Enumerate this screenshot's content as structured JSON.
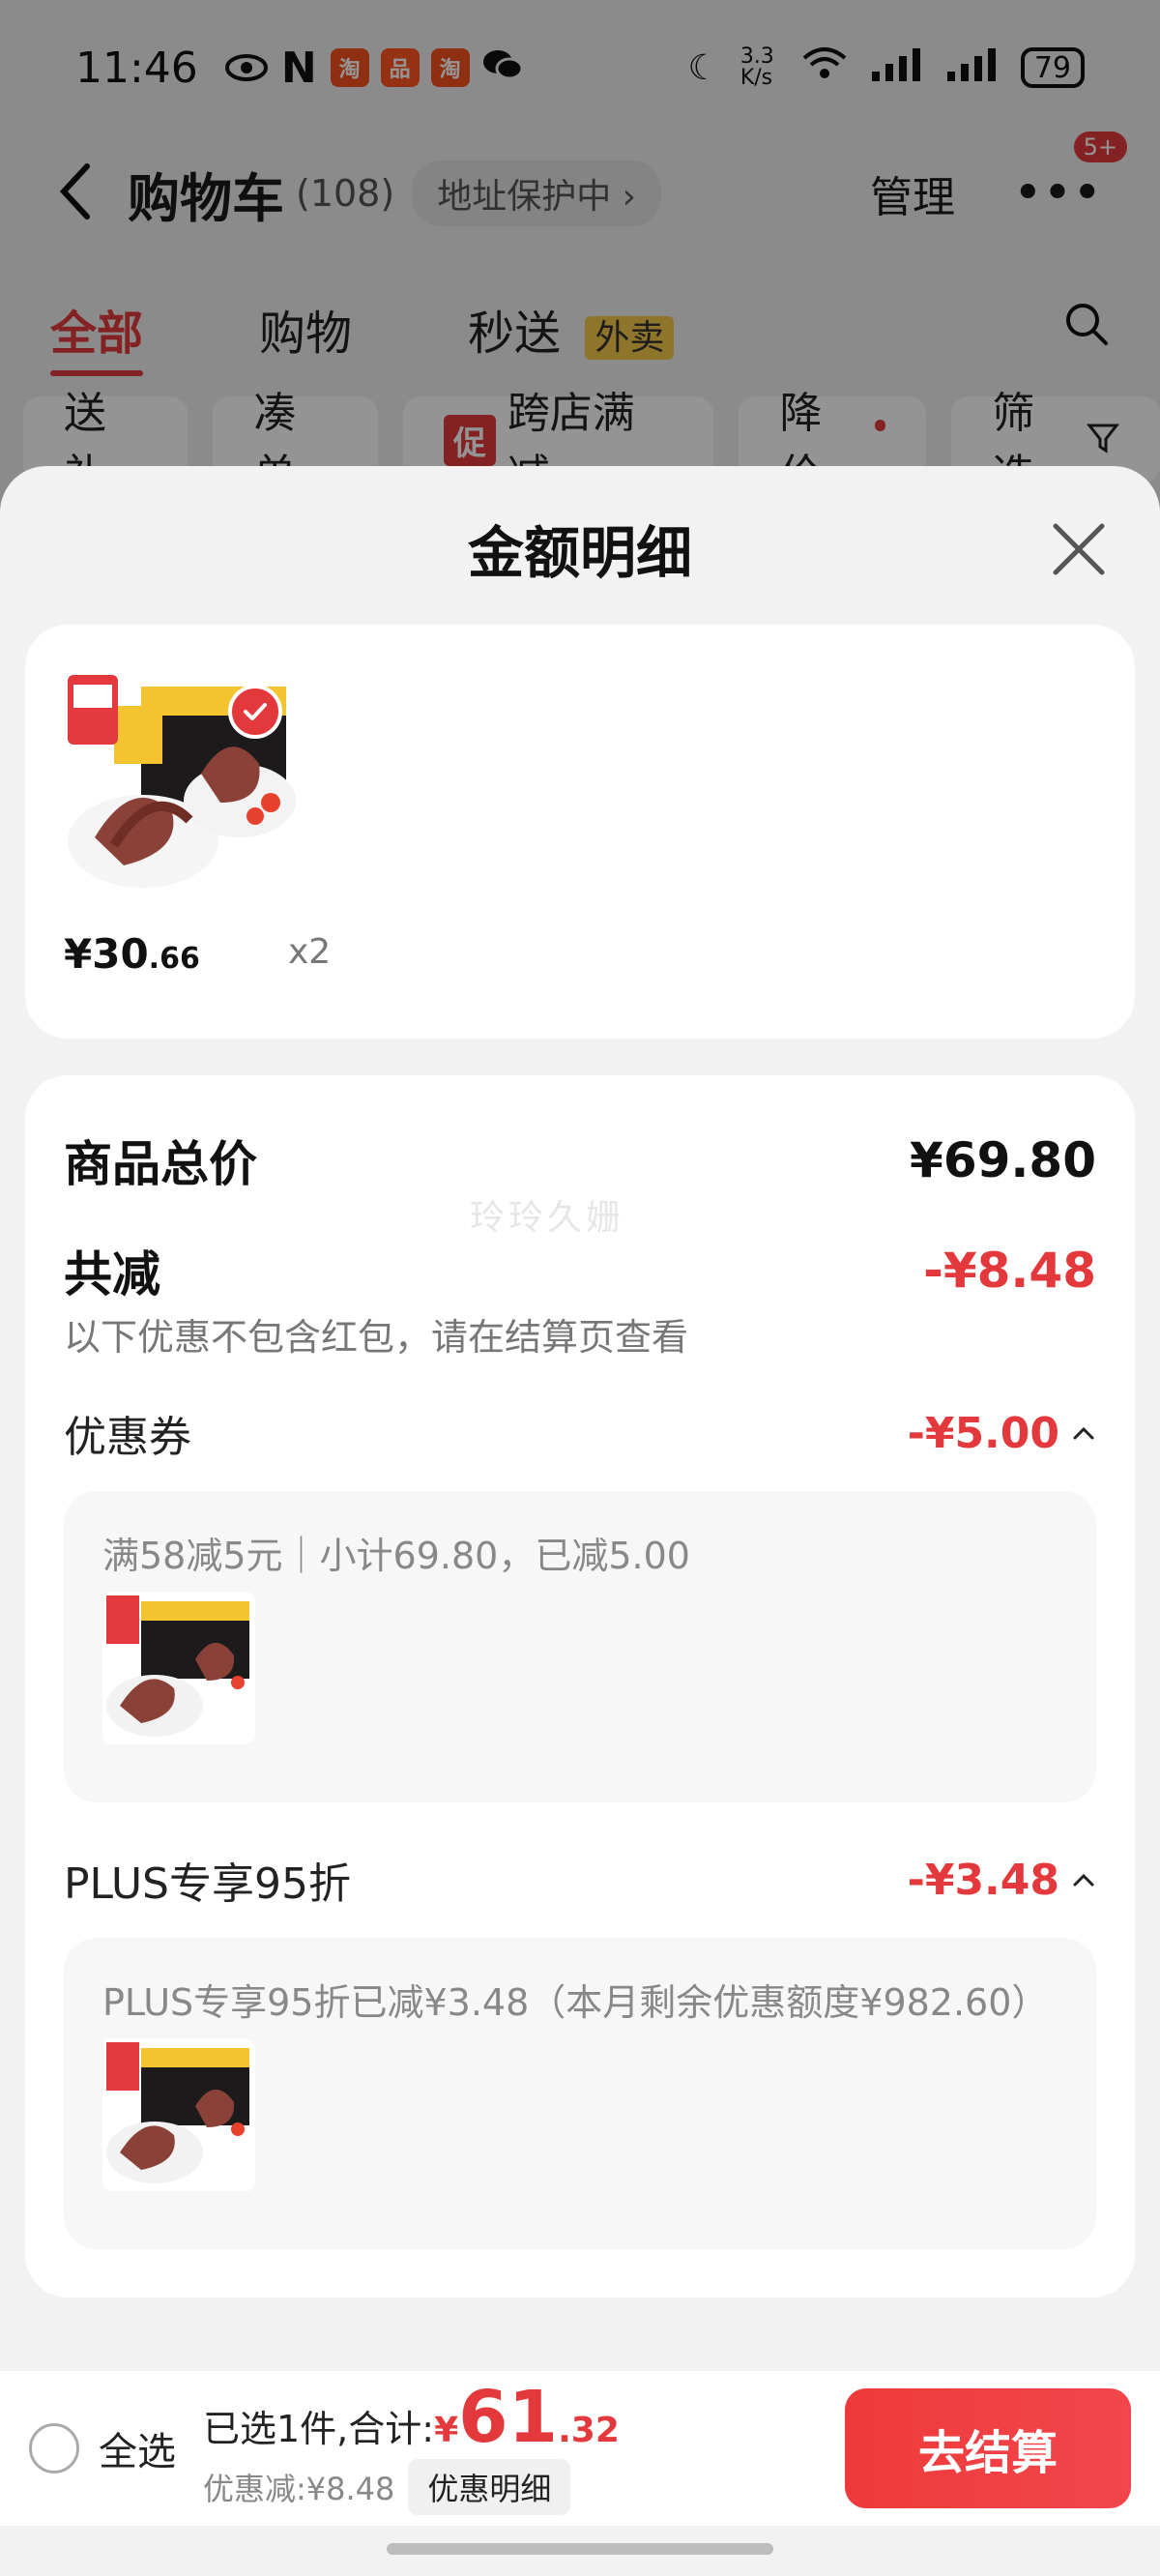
{
  "status_bar": {
    "time": "11:46",
    "network_speed": "3.3 K/s",
    "battery": "79",
    "app_icons": [
      "eye-icon",
      "nfc-icon",
      "taobao-icon",
      "xiaohongshu-icon",
      "taobao-icon",
      "wechat-icon"
    ]
  },
  "header": {
    "title": "购物车",
    "count": "(108)",
    "address_pill": "地址保护中",
    "manage": "管理",
    "more_badge": "5+"
  },
  "tabs": [
    {
      "label": "全部",
      "active": true
    },
    {
      "label": "购物",
      "active": false
    },
    {
      "label": "秒送",
      "badge": "外卖",
      "active": false
    }
  ],
  "chips": [
    {
      "label": "送礼"
    },
    {
      "label": "凑单"
    },
    {
      "label": "跨店满减",
      "icon_text": "促"
    },
    {
      "label": "降价"
    },
    {
      "label": "筛选"
    }
  ],
  "sheet": {
    "title": "金额明细",
    "product": {
      "price_int": "¥30",
      "price_dec": ".66",
      "qty": "x2",
      "check_color": "#e4393c"
    },
    "total": {
      "label": "商品总价",
      "value": "¥69.80"
    },
    "reduced": {
      "label": "共减",
      "value": "-¥8.48",
      "note": "以下优惠不包含红包，请在结算页查看"
    },
    "watermark": "玲玲久姗",
    "coupon": {
      "label": "优惠券",
      "value": "-¥5.00",
      "detail": "满58减5元｜小计69.80，已减5.00"
    },
    "plus": {
      "label": "PLUS专享95折",
      "value": "-¥3.48",
      "detail": "PLUS专享95折已减¥3.48（本月剩余优惠额度¥982.60）"
    }
  },
  "footer": {
    "select_all": "全选",
    "summary_label": "已选1件,合计:",
    "yen": "¥",
    "total_int": "61",
    "total_dec": ".32",
    "discount_text": "优惠减:¥8.48",
    "detail_button": "优惠明细",
    "checkout": "去结算"
  },
  "colors": {
    "accent": "#e4393c",
    "sheet_bg": "#f2f2f2"
  }
}
